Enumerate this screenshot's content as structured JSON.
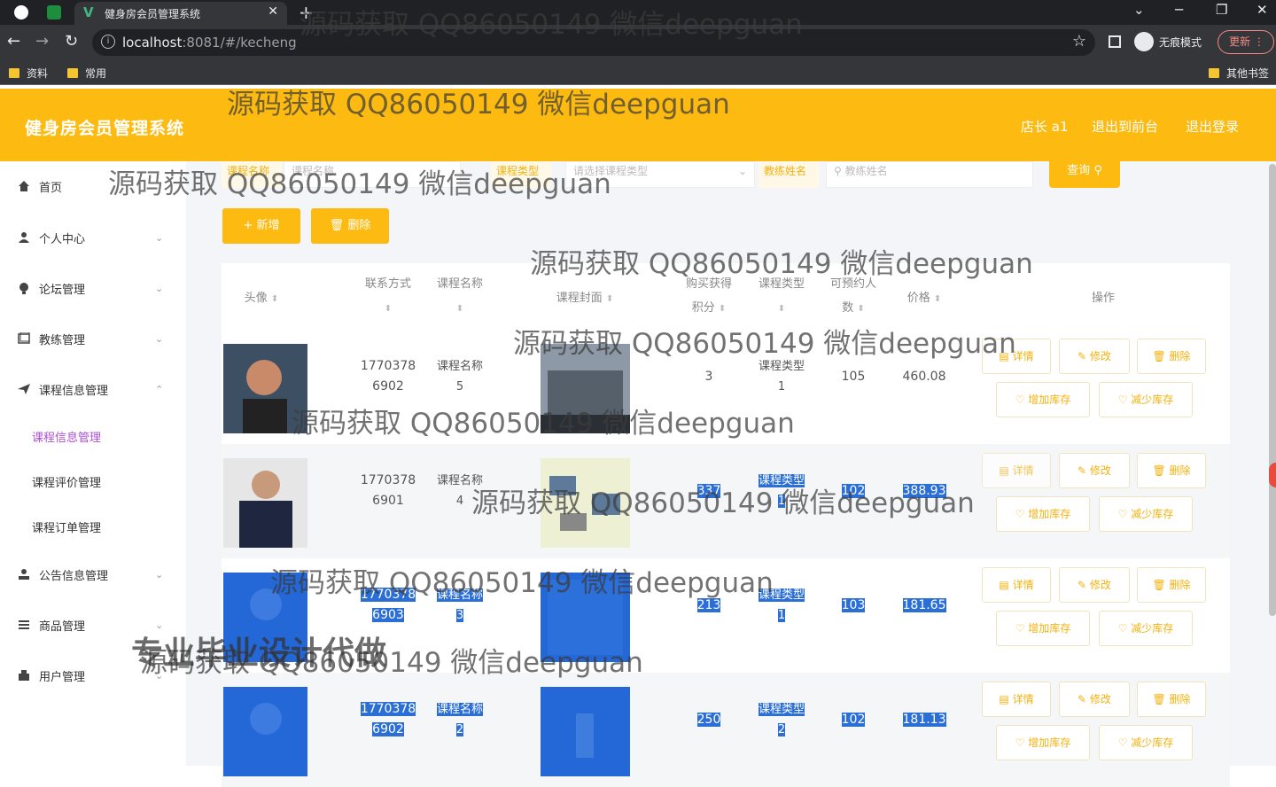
{
  "browser": {
    "tab_title": "健身房会员管理系统",
    "url_host": "localhost",
    "url_rest": ":8081/#/kecheng",
    "incognito_label": "无痕模式",
    "update_label": "更新",
    "bookmarks": [
      "资料",
      "常用"
    ],
    "other_bookmarks": "其他书签"
  },
  "header": {
    "title": "健身房会员管理系统",
    "user": "店长 a1",
    "back_to_front": "退出到前台",
    "logout": "退出登录"
  },
  "sidebar": {
    "items": [
      {
        "label": "首页",
        "icon": "home-icon"
      },
      {
        "label": "个人中心",
        "icon": "user-icon"
      },
      {
        "label": "论坛管理",
        "icon": "forum-icon"
      },
      {
        "label": "教练管理",
        "icon": "coach-icon"
      },
      {
        "label": "课程信息管理",
        "icon": "course-icon"
      },
      {
        "label": "公告信息管理",
        "icon": "notice-icon"
      },
      {
        "label": "商品管理",
        "icon": "goods-icon"
      },
      {
        "label": "用户管理",
        "icon": "users-icon"
      }
    ],
    "sub_items": [
      "课程信息管理",
      "课程评价管理",
      "课程订单管理"
    ]
  },
  "search": {
    "name_label": "课程名称",
    "name_placeholder": "课程名称",
    "type_label": "课程类型",
    "type_placeholder": "请选择课程类型",
    "coach_label": "教练姓名",
    "coach_placeholder": "教练姓名",
    "query_label": "查询"
  },
  "actions": {
    "add": "+ 新增",
    "delete": "删除"
  },
  "table": {
    "headers": {
      "avatar": "头像",
      "contact": "联系方式",
      "course_name": "课程名称",
      "cover": "课程封面",
      "points_1": "购买获得",
      "points_2": "积分",
      "type": "课程类型",
      "seats_1": "可预约人",
      "seats_2": "数",
      "price": "价格",
      "ops": "操作"
    },
    "rows": [
      {
        "contact_1": "1770378",
        "contact_2": "6902",
        "name_1": "课程名称",
        "name_2": "5",
        "points": "3",
        "type_1": "课程类型",
        "type_2": "1",
        "seats": "105",
        "price": "460.08"
      },
      {
        "contact_1": "1770378",
        "contact_2": "6901",
        "name_1": "课程名称",
        "name_2": "4",
        "points": "337",
        "type_1": "课程类型",
        "type_2": "1",
        "seats": "102",
        "price": "388.93"
      },
      {
        "contact_1": "1770378",
        "contact_2": "6903",
        "name_1": "课程名称",
        "name_2": "3",
        "points": "213",
        "type_1": "课程类型",
        "type_2": "1",
        "seats": "103",
        "price": "181.65"
      },
      {
        "contact_1": "1770378",
        "contact_2": "6902",
        "name_1": "课程名称",
        "name_2": "2",
        "points": "250",
        "type_1": "课程类型",
        "type_2": "2",
        "seats": "102",
        "price": "181.13"
      }
    ],
    "op_labels": {
      "detail": "详情",
      "edit": "修改",
      "delete": "删除",
      "add_stock": "增加库存",
      "reduce_stock": "减少库存"
    }
  },
  "watermarks": {
    "text": "源码获取 QQ86050149 微信deepguan",
    "big": "专业毕业设计代做"
  }
}
